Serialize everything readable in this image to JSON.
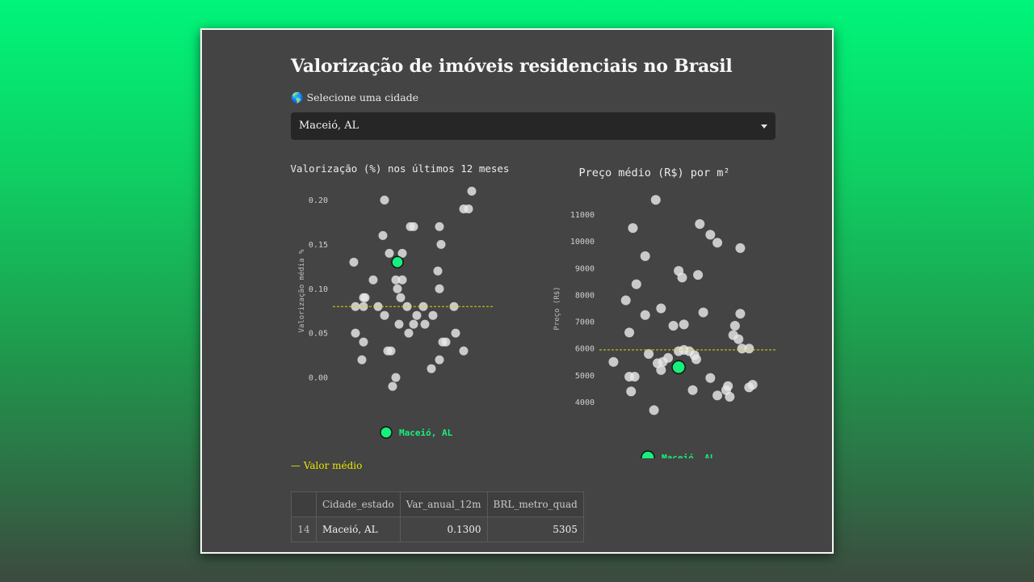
{
  "app": {
    "title": "Valorização de imóveis residenciais no Brasil",
    "select_label": "Selecione uma cidade",
    "globe_icon": "🌎",
    "selected_city": "Maceió, AL",
    "mean_legend": "— Valor médio"
  },
  "colors": {
    "highlight": "#17ef7c",
    "mean_line": "#d8d800",
    "points": "#e8e8e8"
  },
  "chart_data": [
    {
      "type": "scatter",
      "title": "Valorização (%) nos últimos 12 meses",
      "ylabel": "Valorização média %",
      "xlabel": "",
      "ylim": [
        -0.02,
        0.215
      ],
      "yticks": [
        "0.00",
        "0.05",
        "0.10",
        "0.15",
        "0.20"
      ],
      "ytick_values": [
        0,
        0.05,
        0.1,
        0.15,
        0.2
      ],
      "mean": 0.08,
      "legend_label": "Maceió, AL",
      "highlight": {
        "label": "Maceió, AL",
        "value": 0.13
      },
      "series": [
        {
          "values": [
            0.21,
            0.2,
            0.19,
            0.19,
            0.17,
            0.17,
            0.17,
            0.16,
            0.15,
            0.14,
            0.14,
            0.13,
            0.12,
            0.11,
            0.11,
            0.11,
            0.1,
            0.1,
            0.09,
            0.09,
            0.09,
            0.08,
            0.08,
            0.08,
            0.08,
            0.08,
            0.08,
            0.07,
            0.07,
            0.07,
            0.06,
            0.06,
            0.06,
            0.05,
            0.05,
            0.05,
            0.04,
            0.04,
            0.04,
            0.03,
            0.03,
            0.03,
            0.02,
            0.02,
            0.01,
            0.0,
            -0.01
          ],
          "jitter": [
            0.86,
            0.32,
            0.84,
            0.81,
            0.66,
            0.48,
            0.5,
            0.31,
            0.67,
            0.35,
            0.43,
            0.13,
            0.65,
            0.25,
            0.39,
            0.43,
            0.4,
            0.66,
            0.19,
            0.2,
            0.42,
            0.14,
            0.19,
            0.28,
            0.46,
            0.56,
            0.75,
            0.32,
            0.52,
            0.62,
            0.41,
            0.57,
            0.5,
            0.14,
            0.47,
            0.76,
            0.19,
            0.68,
            0.7,
            0.34,
            0.36,
            0.81,
            0.18,
            0.66,
            0.61,
            0.39,
            0.37
          ]
        }
      ]
    },
    {
      "type": "scatter",
      "title": "Preço médio (R$) por m²",
      "ylabel": "Preço (R$)",
      "xlabel": "",
      "ylim": [
        3200,
        11800
      ],
      "yticks": [
        "4000",
        "5000",
        "6000",
        "7000",
        "8000",
        "9000",
        "10000",
        "11000"
      ],
      "ytick_values": [
        4000,
        5000,
        6000,
        7000,
        8000,
        9000,
        10000,
        11000
      ],
      "mean": 5950,
      "legend_label": "Maceió, AL",
      "highlight": {
        "label": "Maceió, AL",
        "value": 5305
      },
      "series": [
        {
          "values": [
            11550,
            10650,
            10500,
            10250,
            9950,
            9750,
            9450,
            8900,
            8750,
            8650,
            8400,
            7800,
            7500,
            7350,
            7300,
            7250,
            6900,
            6850,
            6850,
            6600,
            6500,
            6350,
            6000,
            6000,
            5950,
            5900,
            5900,
            5800,
            5750,
            5650,
            5600,
            5500,
            5500,
            5450,
            5200,
            4950,
            4950,
            4900,
            4650,
            4600,
            4550,
            4450,
            4450,
            4400,
            4250,
            4200,
            3700
          ],
          "jitter": [
            0.32,
            0.57,
            0.19,
            0.63,
            0.67,
            0.8,
            0.26,
            0.45,
            0.56,
            0.47,
            0.21,
            0.15,
            0.35,
            0.59,
            0.8,
            0.26,
            0.48,
            0.42,
            0.77,
            0.17,
            0.76,
            0.79,
            0.81,
            0.85,
            0.48,
            0.51,
            0.45,
            0.28,
            0.54,
            0.39,
            0.55,
            0.36,
            0.08,
            0.33,
            0.35,
            0.17,
            0.2,
            0.63,
            0.87,
            0.73,
            0.85,
            0.53,
            0.72,
            0.18,
            0.67,
            0.74,
            0.31
          ]
        }
      ]
    }
  ],
  "table": {
    "headers": [
      "",
      "Cidade_estado",
      "Var_anual_12m",
      "BRL_metro_quad"
    ],
    "row": {
      "index": "14",
      "city": "Maceió, AL",
      "var": "0.1300",
      "brl": "5305"
    }
  }
}
